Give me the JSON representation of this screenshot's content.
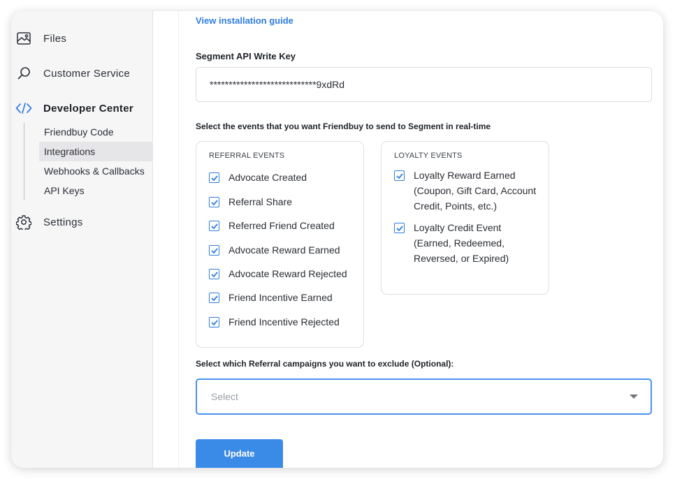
{
  "sidebar": {
    "items": [
      {
        "label": "Files",
        "icon": "image-icon"
      },
      {
        "label": "Customer Service",
        "icon": "search-icon"
      },
      {
        "label": "Developer Center",
        "icon": "code-icon"
      },
      {
        "label": "Settings",
        "icon": "gear-icon"
      }
    ],
    "sub_items": [
      {
        "label": "Friendbuy Code"
      },
      {
        "label": "Integrations",
        "active": true
      },
      {
        "label": "Webhooks & Callbacks"
      },
      {
        "label": "API Keys"
      }
    ]
  },
  "main": {
    "install_link": "View installation guide",
    "api_key_label": "Segment API Write Key",
    "api_key_value": "****************************9xdRd",
    "events_prompt": "Select the events that you want Friendbuy to send to Segment in real-time",
    "referral_events": {
      "title": "REFERRAL EVENTS",
      "items": [
        {
          "label": "Advocate Created",
          "checked": true
        },
        {
          "label": "Referral Share",
          "checked": true
        },
        {
          "label": "Referred Friend Created",
          "checked": true
        },
        {
          "label": "Advocate Reward Earned",
          "checked": true
        },
        {
          "label": "Advocate Reward Rejected",
          "checked": true
        },
        {
          "label": "Friend Incentive Earned",
          "checked": true
        },
        {
          "label": "Friend Incentive Rejected",
          "checked": true
        }
      ]
    },
    "loyalty_events": {
      "title": "LOYALTY EVENTS",
      "items": [
        {
          "label": "Loyalty Reward Earned (Coupon, Gift Card, Account Credit, Points, etc.)",
          "checked": true
        },
        {
          "label": "Loyalty Credit Event (Earned, Redeemed, Reversed, or Expired)",
          "checked": true
        }
      ]
    },
    "exclude_label": "Select which Referral campaigns you want to exclude (Optional):",
    "exclude_select": {
      "placeholder": "Select"
    },
    "update_button": "Update"
  },
  "colors": {
    "accent": "#2f7de1",
    "button": "#3a8ae8",
    "sidebar_bg": "#f6f6f7",
    "active_item_bg": "#e6e6e8"
  }
}
